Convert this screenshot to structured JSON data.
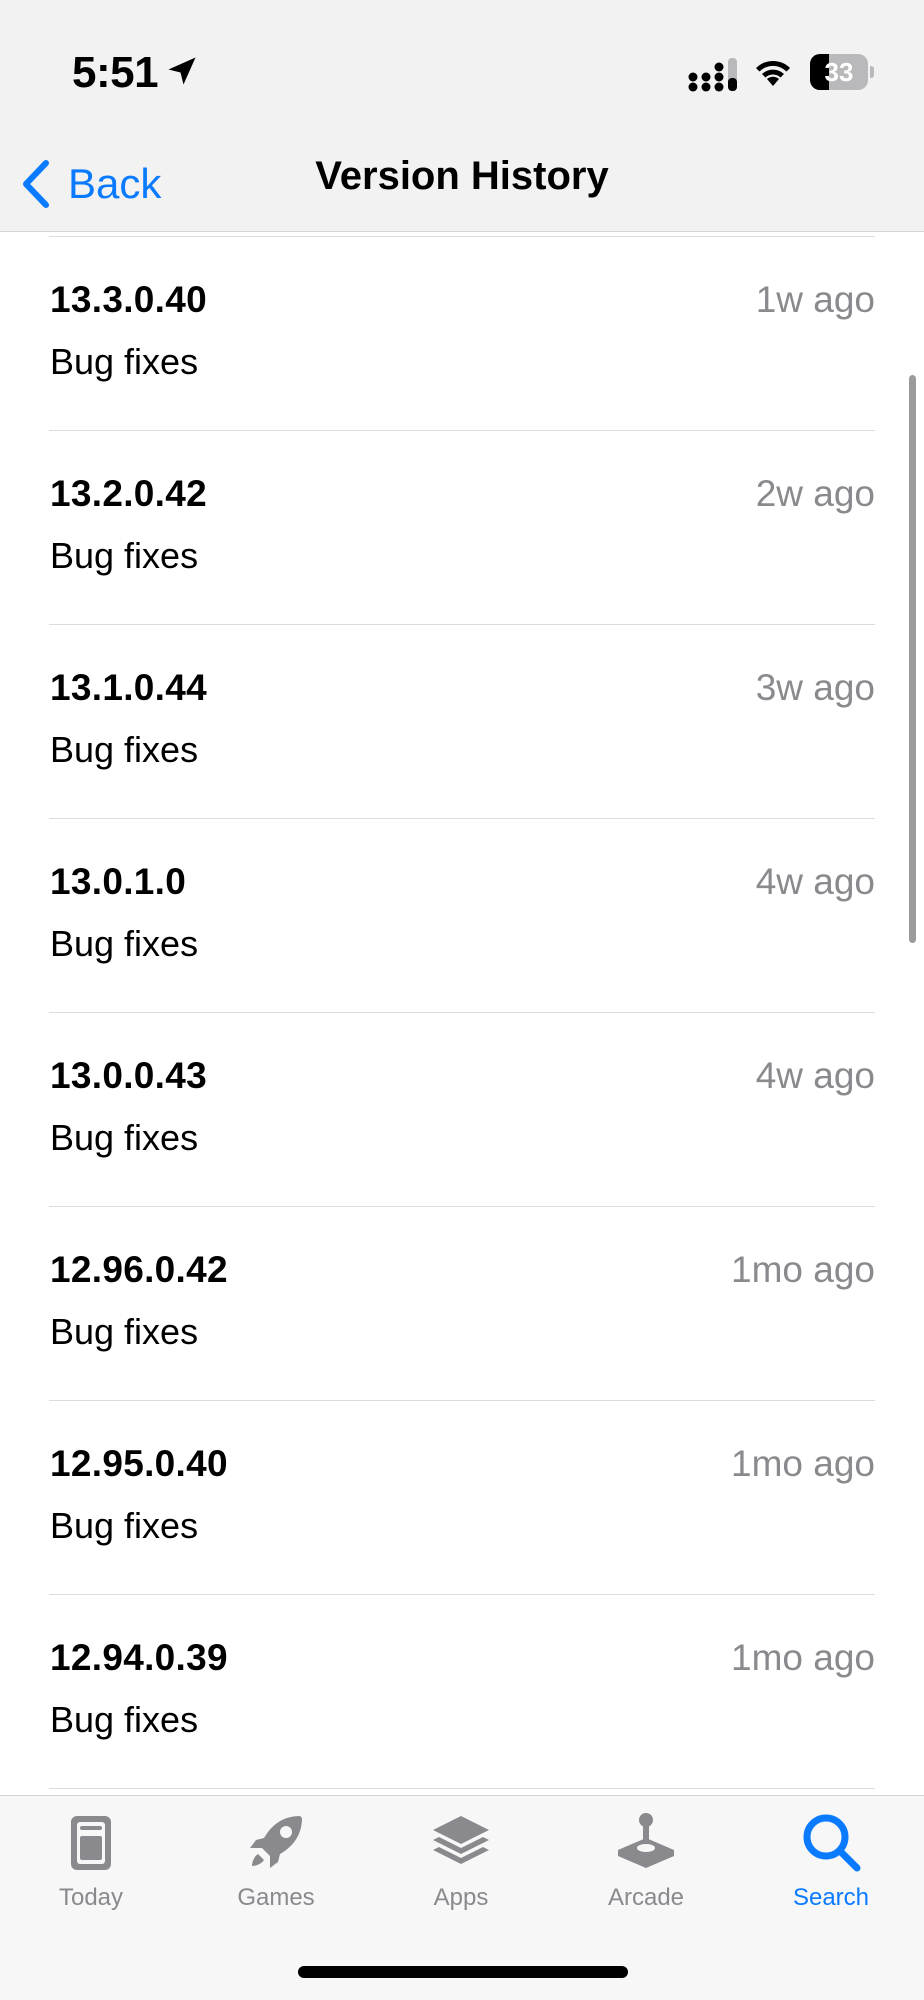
{
  "status_bar": {
    "time": "5:51",
    "battery_level": "33",
    "battery_fraction": 0.33
  },
  "nav": {
    "back_label": "Back",
    "title": "Version History"
  },
  "versions": [
    {
      "number": "13.3.0.40",
      "date": "1w ago",
      "notes": "Bug fixes"
    },
    {
      "number": "13.2.0.42",
      "date": "2w ago",
      "notes": "Bug fixes"
    },
    {
      "number": "13.1.0.44",
      "date": "3w ago",
      "notes": "Bug fixes"
    },
    {
      "number": "13.0.1.0",
      "date": "4w ago",
      "notes": "Bug fixes"
    },
    {
      "number": "13.0.0.43",
      "date": "4w ago",
      "notes": "Bug fixes"
    },
    {
      "number": "12.96.0.42",
      "date": "1mo ago",
      "notes": "Bug fixes"
    },
    {
      "number": "12.95.0.40",
      "date": "1mo ago",
      "notes": "Bug fixes"
    },
    {
      "number": "12.94.0.39",
      "date": "1mo ago",
      "notes": "Bug fixes"
    }
  ],
  "tab_bar": {
    "tabs": [
      {
        "label": "Today",
        "icon": "today-icon",
        "active": false
      },
      {
        "label": "Games",
        "icon": "rocket-icon",
        "active": false
      },
      {
        "label": "Apps",
        "icon": "layers-icon",
        "active": false
      },
      {
        "label": "Arcade",
        "icon": "joystick-icon",
        "active": false
      },
      {
        "label": "Search",
        "icon": "search-icon",
        "active": true
      }
    ]
  },
  "colors": {
    "accent": "#0a7aff",
    "secondary_text": "#8a8a8e",
    "bar_background": "#f2f2f3"
  }
}
